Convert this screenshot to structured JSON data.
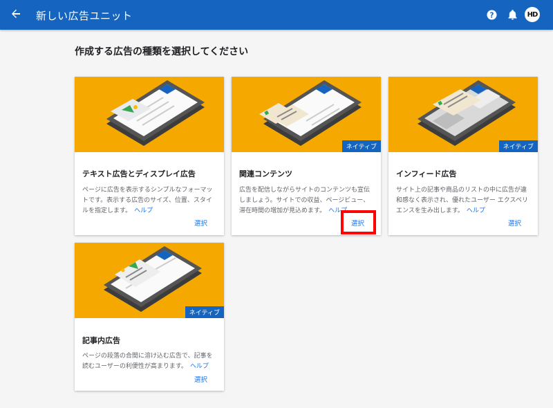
{
  "header": {
    "title": "新しい広告ユニット",
    "avatar_text": "HD",
    "color": "#1565c0"
  },
  "page": {
    "heading": "作成する広告の種類を選択してください"
  },
  "cards": [
    {
      "title": "テキスト広告とディスプレイ広告",
      "description": "ページに広告を表示するシンプルなフォーマットです。表示する広告のサイズ、位置、スタイルを指定します。",
      "help_label": "ヘルプ",
      "select_label": "選択",
      "badge": ""
    },
    {
      "title": "関連コンテンツ",
      "description": "広告を配信しながらサイトのコンテンツも宣伝しましょう。サイトでの収益、ページビュー、滞在時間の増加が見込めます。",
      "help_label": "ヘルプ",
      "select_label": "選択",
      "badge": "ネイティブ"
    },
    {
      "title": "インフィード広告",
      "description": "サイト上の記事や商品のリストの中に広告が違和感なく表示され、優れたユーザー エクスペリエンスを生み出します。",
      "help_label": "ヘルプ",
      "select_label": "選択",
      "badge": "ネイティブ"
    },
    {
      "title": "記事内広告",
      "description": "ページの段落の合間に溶け込む広告で、記事を読むユーザーの利便性が高まります。",
      "help_label": "ヘルプ",
      "select_label": "選択",
      "badge": "ネイティブ"
    }
  ],
  "colors": {
    "hero_background": "#f4a800",
    "link": "#1a73e8",
    "highlight": "#ff0000"
  }
}
